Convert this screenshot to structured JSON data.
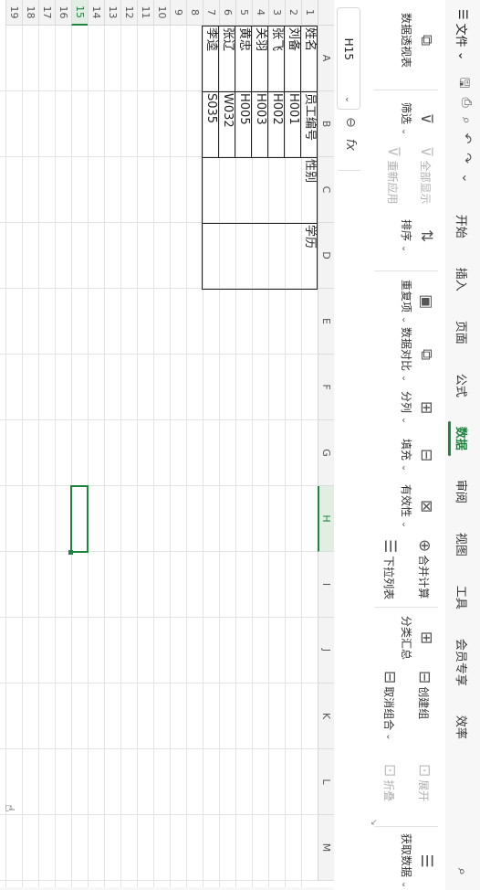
{
  "menubar": {
    "hamburger": "☰",
    "file_label": "文件",
    "tabs": [
      {
        "label": "开始",
        "active": false
      },
      {
        "label": "插入",
        "active": false
      },
      {
        "label": "页面",
        "active": false
      },
      {
        "label": "公式",
        "active": false
      },
      {
        "label": "数据",
        "active": true
      },
      {
        "label": "审阅",
        "active": false
      },
      {
        "label": "视图",
        "active": false
      },
      {
        "label": "工具",
        "active": false
      },
      {
        "label": "会员专享",
        "active": false
      },
      {
        "label": "效率",
        "active": false
      }
    ]
  },
  "ribbon": {
    "pivot": "数据透视表",
    "filter": "筛选",
    "show_all": "全部显示",
    "reapply": "重新应用",
    "sort": "排序",
    "duplicates": "重复项",
    "compare": "数据对比",
    "split": "分列",
    "fill": "填充",
    "validity": "有效性",
    "dropdown_list": "下拉列表",
    "consolidate": "合并计算",
    "subtotal": "分类汇总",
    "create_group": "创建组",
    "ungroup": "取消组合",
    "expand": "展开",
    "collapse": "折叠",
    "get_data": "获取数据"
  },
  "formula_bar": {
    "cell_ref": "H15",
    "fx": "fx",
    "value": ""
  },
  "grid": {
    "columns": [
      "A",
      "B",
      "C",
      "D",
      "E",
      "F",
      "G",
      "H",
      "I",
      "J",
      "K",
      "L",
      "M"
    ],
    "selected_column": "H",
    "rows": [
      "1",
      "2",
      "3",
      "4",
      "5",
      "6",
      "7",
      "8",
      "9",
      "10",
      "11",
      "12",
      "13",
      "14",
      "15",
      "16",
      "17",
      "18",
      "19"
    ],
    "selected_row": "15",
    "cells": {
      "A1": "姓名",
      "B1": "员工编号",
      "C1": "性别",
      "D1": "学历",
      "A2": "刘备",
      "B2": "H001",
      "A3": "张飞",
      "B3": "H002",
      "A4": "关羽",
      "B4": "H003",
      "A5": "黄忠",
      "B5": "H005",
      "A6": "张辽",
      "B6": "W032",
      "A7": "李逵",
      "B7": "S035"
    }
  }
}
